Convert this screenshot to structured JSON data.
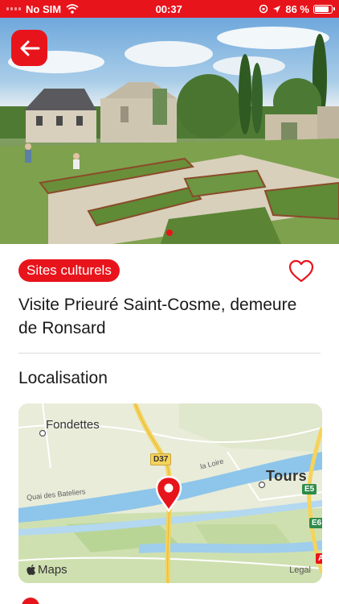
{
  "status_bar": {
    "carrier": "No SIM",
    "time": "00:37",
    "battery": "86 %",
    "battery_level": 0.86
  },
  "hero": {
    "image_count_dots": 1,
    "active_dot": 0
  },
  "category": "Sites culturels",
  "title": "Visite Prieuré Saint-Cosme, demeure de Ronsard",
  "section_title": "Localisation",
  "map": {
    "labels": {
      "fondettes": "Fondettes",
      "tours": "Tours",
      "river": "la Loire",
      "quai": "Quai des Bateliers",
      "d37": "D37",
      "e5": "E5",
      "e6": "E6",
      "a": "A"
    },
    "attribution": "Maps",
    "legal": "Legal"
  },
  "colors": {
    "brand": "#e8141b",
    "river": "#8ec5ea",
    "road": "#f5d35c"
  }
}
